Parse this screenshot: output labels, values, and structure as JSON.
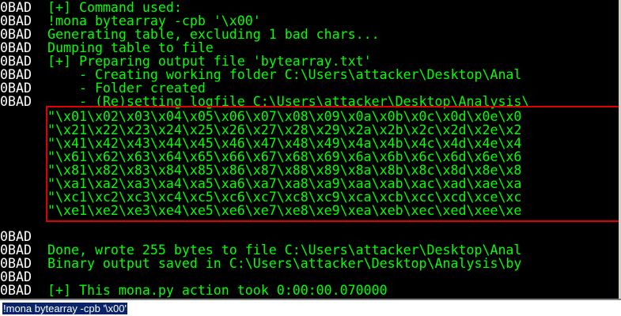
{
  "console": {
    "lines": [
      {
        "addr": "0BAD",
        "text": "[+] Command used:"
      },
      {
        "addr": "0BAD",
        "text": "!mona bytearray -cpb '\\x00'"
      },
      {
        "addr": "0BAD",
        "text": "Generating table, excluding 1 bad chars..."
      },
      {
        "addr": "0BAD",
        "text": "Dumping table to file"
      },
      {
        "addr": "0BAD",
        "text": "[+] Preparing output file 'bytearray.txt'"
      },
      {
        "addr": "0BAD",
        "text": "    - Creating working folder C:\\Users\\attacker\\Desktop\\Anal"
      },
      {
        "addr": "0BAD",
        "text": "    - Folder created"
      },
      {
        "addr": "0BAD",
        "text": "    - (Re)setting logfile C:\\Users\\attacker\\Desktop\\Analysis\\"
      },
      {
        "addr": "",
        "text": "\"\\x01\\x02\\x03\\x04\\x05\\x06\\x07\\x08\\x09\\x0a\\x0b\\x0c\\x0d\\x0e\\x0"
      },
      {
        "addr": "",
        "text": "\"\\x21\\x22\\x23\\x24\\x25\\x26\\x27\\x28\\x29\\x2a\\x2b\\x2c\\x2d\\x2e\\x2"
      },
      {
        "addr": "",
        "text": "\"\\x41\\x42\\x43\\x44\\x45\\x46\\x47\\x48\\x49\\x4a\\x4b\\x4c\\x4d\\x4e\\x4"
      },
      {
        "addr": "",
        "text": "\"\\x61\\x62\\x63\\x64\\x65\\x66\\x67\\x68\\x69\\x6a\\x6b\\x6c\\x6d\\x6e\\x6"
      },
      {
        "addr": "",
        "text": "\"\\x81\\x82\\x83\\x84\\x85\\x86\\x87\\x88\\x89\\x8a\\x8b\\x8c\\x8d\\x8e\\x8"
      },
      {
        "addr": "",
        "text": "\"\\xa1\\xa2\\xa3\\xa4\\xa5\\xa6\\xa7\\xa8\\xa9\\xaa\\xab\\xac\\xad\\xae\\xa"
      },
      {
        "addr": "",
        "text": "\"\\xc1\\xc2\\xc3\\xc4\\xc5\\xc6\\xc7\\xc8\\xc9\\xca\\xcb\\xcc\\xcd\\xce\\xc"
      },
      {
        "addr": "",
        "text": "\"\\xe1\\xe2\\xe3\\xe4\\xe5\\xe6\\xe7\\xe8\\xe9\\xea\\xeb\\xec\\xed\\xee\\xe"
      },
      {
        "addr": "0BAD",
        "text": ""
      },
      {
        "addr": "0BAD",
        "text": "Done, wrote 255 bytes to file C:\\Users\\attacker\\Desktop\\Anal"
      },
      {
        "addr": "0BAD",
        "text": "Binary output saved in C:\\Users\\attacker\\Desktop\\Analysis\\by"
      },
      {
        "addr": "0BAD",
        "text": ""
      },
      {
        "addr": "0BAD",
        "text": "[+] This mona.py action took 0:00:00.070000"
      }
    ]
  },
  "command_bar": {
    "value": "!mona bytearray -cpb '\\x00'"
  },
  "colors": {
    "background": "#000000",
    "address": "#ffffff",
    "message": "#00ff00",
    "highlight_box": "#e00000",
    "selection": "#0a246a"
  }
}
